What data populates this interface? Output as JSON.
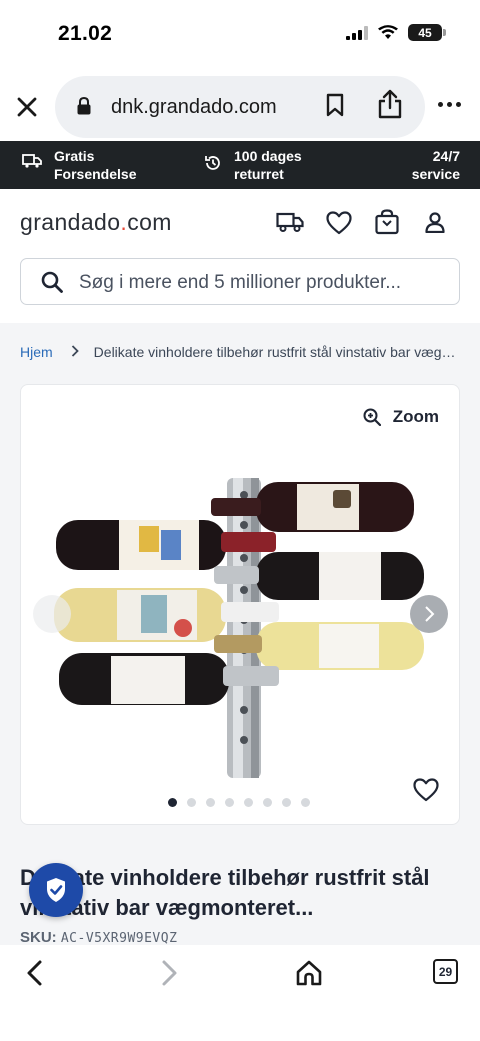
{
  "status_bar": {
    "time": "21.02",
    "battery": "45"
  },
  "browser": {
    "url": "dnk.grandado.com"
  },
  "promo": {
    "shipping": {
      "line1": "Gratis",
      "line2": "Forsendelse"
    },
    "returns": {
      "line1": "100 dages",
      "line2": "returret"
    },
    "service": {
      "line1": "24/7",
      "line2": "service"
    }
  },
  "header": {
    "logo_main": "grandado",
    "logo_dot": ".",
    "logo_tld": "com",
    "search_placeholder": "Søg i mere end 5 millioner produkter..."
  },
  "breadcrumb": {
    "home": "Hjem",
    "current": "Delikate vinholdere tilbehør rustfrit stål vinstativ bar vægmonteret..."
  },
  "gallery": {
    "zoom_label": "Zoom",
    "image_count": 8,
    "active_index": 0
  },
  "product": {
    "title": "Delikate vinholdere tilbehør rustfrit stål vinstativ bar vægmonteret...",
    "sku_label": "SKU:",
    "sku_value": "AC-V5XR9W9EVQZ"
  },
  "toolbar": {
    "tab_count": "29"
  },
  "colors": {
    "accent": "#2a6bb8",
    "promo_bg": "#1f2326",
    "badge": "#1e4aa8"
  }
}
